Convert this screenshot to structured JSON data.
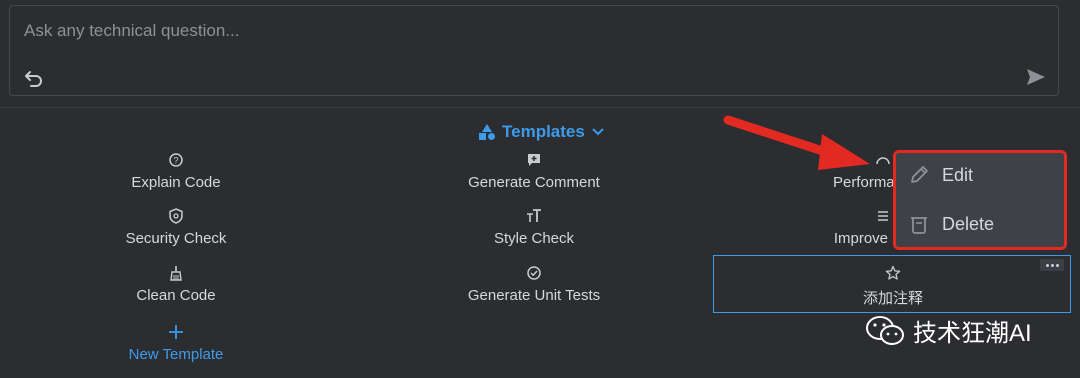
{
  "composer": {
    "placeholder": "Ask any technical question..."
  },
  "templates_header": {
    "label": "Templates"
  },
  "templates": [
    {
      "label": "Explain Code",
      "icon": "question-circle-icon"
    },
    {
      "label": "Generate Comment",
      "icon": "comment-plus-icon"
    },
    {
      "label": "Performan",
      "icon": "gauge-icon"
    },
    {
      "label": "Security Check",
      "icon": "shield-icon"
    },
    {
      "label": "Style Check",
      "icon": "text-size-icon"
    },
    {
      "label": "Improve R",
      "icon": "list-icon"
    },
    {
      "label": "Clean Code",
      "icon": "broom-icon"
    },
    {
      "label": "Generate Unit Tests",
      "icon": "check-circle-icon"
    },
    {
      "label": "添加注释",
      "icon": "star-icon"
    }
  ],
  "new_template": {
    "label": "New Template"
  },
  "context_menu": {
    "edit_label": "Edit",
    "delete_label": "Delete"
  },
  "watermark": {
    "text": "技术狂潮AI"
  },
  "colors": {
    "background": "#2b2d31",
    "accent": "#3d9be9",
    "annotation_red": "#e32a22"
  }
}
